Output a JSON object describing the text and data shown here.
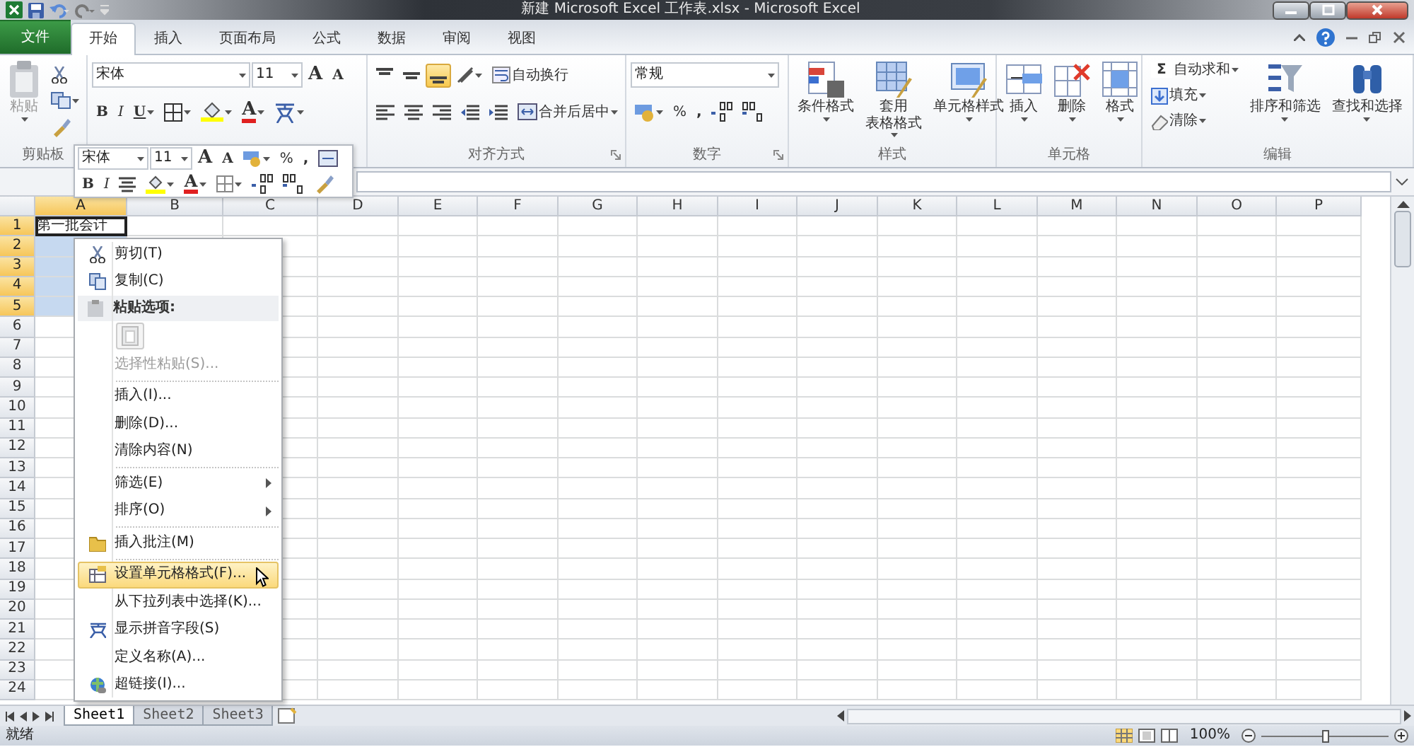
{
  "window": {
    "title": "新建 Microsoft Excel 工作表.xlsx - Microsoft Excel"
  },
  "ribbon_tabs": [
    {
      "label": "文件",
      "kind": "file",
      "selected": false
    },
    {
      "label": "开始",
      "kind": "tab",
      "selected": true
    },
    {
      "label": "插入",
      "kind": "tab",
      "selected": false
    },
    {
      "label": "页面布局",
      "kind": "tab",
      "selected": false
    },
    {
      "label": "公式",
      "kind": "tab",
      "selected": false
    },
    {
      "label": "数据",
      "kind": "tab",
      "selected": false
    },
    {
      "label": "审阅",
      "kind": "tab",
      "selected": false
    },
    {
      "label": "视图",
      "kind": "tab",
      "selected": false
    }
  ],
  "clipboard": {
    "label": "剪贴板",
    "paste": "粘贴"
  },
  "font": {
    "name": "宋体",
    "size": "11",
    "grow": "A",
    "shrink": "A",
    "bold": "B",
    "italic": "I",
    "underline": "U",
    "font_color_letter": "A"
  },
  "alignment": {
    "label": "对齐方式",
    "wrap": "自动换行",
    "merge": "合并后居中",
    "vertical_align": [
      {
        "selected": false
      },
      {
        "selected": false
      },
      {
        "selected": true
      }
    ]
  },
  "number": {
    "label": "数字",
    "format": "常规",
    "percent": "%",
    "comma": ","
  },
  "styles": {
    "label": "样式",
    "buttons": [
      [
        "条件格式"
      ],
      [
        "套用",
        "表格格式"
      ],
      [
        "单元格样式"
      ]
    ]
  },
  "cells_group": {
    "label": "单元格",
    "buttons": [
      "插入",
      "删除",
      "格式"
    ]
  },
  "editing": {
    "label": "编辑",
    "sum_symbol": "Σ",
    "small_buttons": [
      "自动求和",
      "填充",
      "清除"
    ],
    "buttons": [
      "排序和筛选",
      "查找和选择"
    ]
  },
  "mini_toolbar": {
    "font": "宋体",
    "size": "11",
    "grow": "A",
    "shrink": "A",
    "percent": "%",
    "comma": ",",
    "bold": "B",
    "italic": "I",
    "font_color_letter": "A"
  },
  "columns": [
    {
      "label": "A",
      "selected": true
    },
    {
      "label": "B",
      "selected": false
    },
    {
      "label": "C",
      "selected": false
    },
    {
      "label": "D",
      "selected": false
    },
    {
      "label": "E",
      "selected": false
    },
    {
      "label": "F",
      "selected": false
    },
    {
      "label": "G",
      "selected": false
    },
    {
      "label": "H",
      "selected": false
    },
    {
      "label": "I",
      "selected": false
    },
    {
      "label": "J",
      "selected": false
    },
    {
      "label": "K",
      "selected": false
    },
    {
      "label": "L",
      "selected": false
    },
    {
      "label": "M",
      "selected": false
    },
    {
      "label": "N",
      "selected": false
    },
    {
      "label": "O",
      "selected": false
    },
    {
      "label": "P",
      "selected": false
    }
  ],
  "rows": [
    {
      "label": "1",
      "selected": true
    },
    {
      "label": "2",
      "selected": true
    },
    {
      "label": "3",
      "selected": true
    },
    {
      "label": "4",
      "selected": true
    },
    {
      "label": "5",
      "selected": true
    },
    {
      "label": "6",
      "selected": false
    },
    {
      "label": "7",
      "selected": false
    },
    {
      "label": "8",
      "selected": false
    },
    {
      "label": "9",
      "selected": false
    },
    {
      "label": "10",
      "selected": false
    },
    {
      "label": "11",
      "selected": false
    },
    {
      "label": "12",
      "selected": false
    },
    {
      "label": "13",
      "selected": false
    },
    {
      "label": "14",
      "selected": false
    },
    {
      "label": "15",
      "selected": false
    },
    {
      "label": "16",
      "selected": false
    },
    {
      "label": "17",
      "selected": false
    },
    {
      "label": "18",
      "selected": false
    },
    {
      "label": "19",
      "selected": false
    },
    {
      "label": "20",
      "selected": false
    },
    {
      "label": "21",
      "selected": false
    },
    {
      "label": "22",
      "selected": false
    },
    {
      "label": "23",
      "selected": false
    },
    {
      "label": "24",
      "selected": false
    }
  ],
  "cell_a1": "第一批会计",
  "context_menu": [
    {
      "kind": "item",
      "label": "剪切(T)",
      "selected": false,
      "disabled": false,
      "submenu": false
    },
    {
      "kind": "item",
      "label": "复制(C)",
      "selected": false,
      "disabled": false,
      "submenu": false
    },
    {
      "kind": "header",
      "label": "粘贴选项:"
    },
    {
      "kind": "paste_options"
    },
    {
      "kind": "item",
      "label": "选择性粘贴(S)...",
      "selected": false,
      "disabled": true,
      "submenu": false
    },
    {
      "kind": "separator"
    },
    {
      "kind": "item",
      "label": "插入(I)...",
      "selected": false,
      "disabled": false,
      "submenu": false
    },
    {
      "kind": "item",
      "label": "删除(D)...",
      "selected": false,
      "disabled": false,
      "submenu": false
    },
    {
      "kind": "item",
      "label": "清除内容(N)",
      "selected": false,
      "disabled": false,
      "submenu": false
    },
    {
      "kind": "separator"
    },
    {
      "kind": "item",
      "label": "筛选(E)",
      "selected": false,
      "disabled": false,
      "submenu": true
    },
    {
      "kind": "item",
      "label": "排序(O)",
      "selected": false,
      "disabled": false,
      "submenu": true
    },
    {
      "kind": "separator"
    },
    {
      "kind": "item",
      "label": "插入批注(M)",
      "selected": false,
      "disabled": false,
      "submenu": false
    },
    {
      "kind": "separator"
    },
    {
      "kind": "item",
      "label": "设置单元格格式(F)...",
      "selected": true,
      "disabled": false,
      "submenu": false
    },
    {
      "kind": "item",
      "label": "从下拉列表中选择(K)...",
      "selected": false,
      "disabled": false,
      "submenu": false
    },
    {
      "kind": "item",
      "label": "显示拼音字段(S)",
      "selected": false,
      "disabled": false,
      "submenu": false
    },
    {
      "kind": "item",
      "label": "定义名称(A)...",
      "selected": false,
      "disabled": false,
      "submenu": false
    },
    {
      "kind": "item",
      "label": "超链接(I)...",
      "selected": false,
      "disabled": false,
      "submenu": false
    }
  ],
  "sheet_tabs": [
    {
      "label": "Sheet1",
      "selected": true
    },
    {
      "label": "Sheet2",
      "selected": false
    },
    {
      "label": "Sheet3",
      "selected": false
    }
  ],
  "status_bar": {
    "text": "就绪",
    "zoom": "100%",
    "zoom_slider": {
      "level": 0.5
    }
  }
}
